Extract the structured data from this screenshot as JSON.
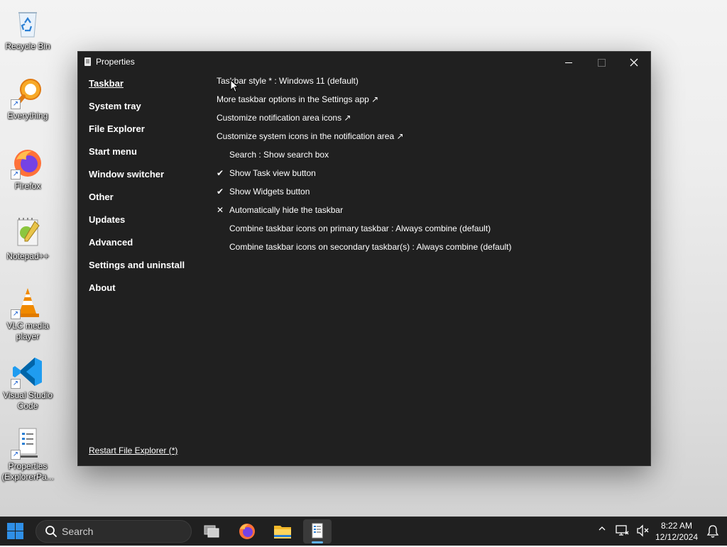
{
  "desktop": {
    "icons": [
      {
        "label": "Recycle Bin"
      },
      {
        "label": "Everything"
      },
      {
        "label": "Firefox"
      },
      {
        "label": "Notepad++"
      },
      {
        "label": "VLC media player"
      },
      {
        "label": "Visual Studio Code"
      },
      {
        "label": "Properties (ExplorerPa..."
      }
    ]
  },
  "window": {
    "title": "Properties",
    "sidebar": [
      {
        "label": "Taskbar",
        "active": true
      },
      {
        "label": "System tray"
      },
      {
        "label": "File Explorer"
      },
      {
        "label": "Start menu"
      },
      {
        "label": "Window switcher"
      },
      {
        "label": "Other"
      },
      {
        "label": "Updates"
      },
      {
        "label": "Advanced"
      },
      {
        "label": "Settings and uninstall"
      },
      {
        "label": "About"
      }
    ],
    "restart_link": "Restart File Explorer (*)",
    "options": [
      {
        "label": "Taskbar style * : Windows 11 (default)",
        "mark": "",
        "type": "link"
      },
      {
        "label": "More taskbar options in the Settings app ↗",
        "mark": "",
        "type": "link"
      },
      {
        "label": "Customize notification area icons ↗",
        "mark": "",
        "type": "link"
      },
      {
        "label": "Customize system icons in the notification area ↗",
        "mark": "",
        "type": "link"
      },
      {
        "label": "Search : Show search box",
        "mark": "",
        "type": "option"
      },
      {
        "label": "Show Task view button",
        "mark": "✔",
        "type": "checkbox"
      },
      {
        "label": "Show Widgets button",
        "mark": "✔",
        "type": "checkbox"
      },
      {
        "label": "Automatically hide the taskbar",
        "mark": "✕",
        "type": "checkbox"
      },
      {
        "label": "Combine taskbar icons on primary taskbar : Always combine (default)",
        "mark": "",
        "type": "option"
      },
      {
        "label": "Combine taskbar icons on secondary taskbar(s) : Always combine (default)",
        "mark": "",
        "type": "option"
      }
    ]
  },
  "taskbar": {
    "search_placeholder": "Search",
    "time": "8:22 AM",
    "date": "12/12/2024"
  },
  "colors": {
    "window_bg": "#202020",
    "taskbar_bg": "#202020",
    "accent": "#5fb2f2"
  }
}
